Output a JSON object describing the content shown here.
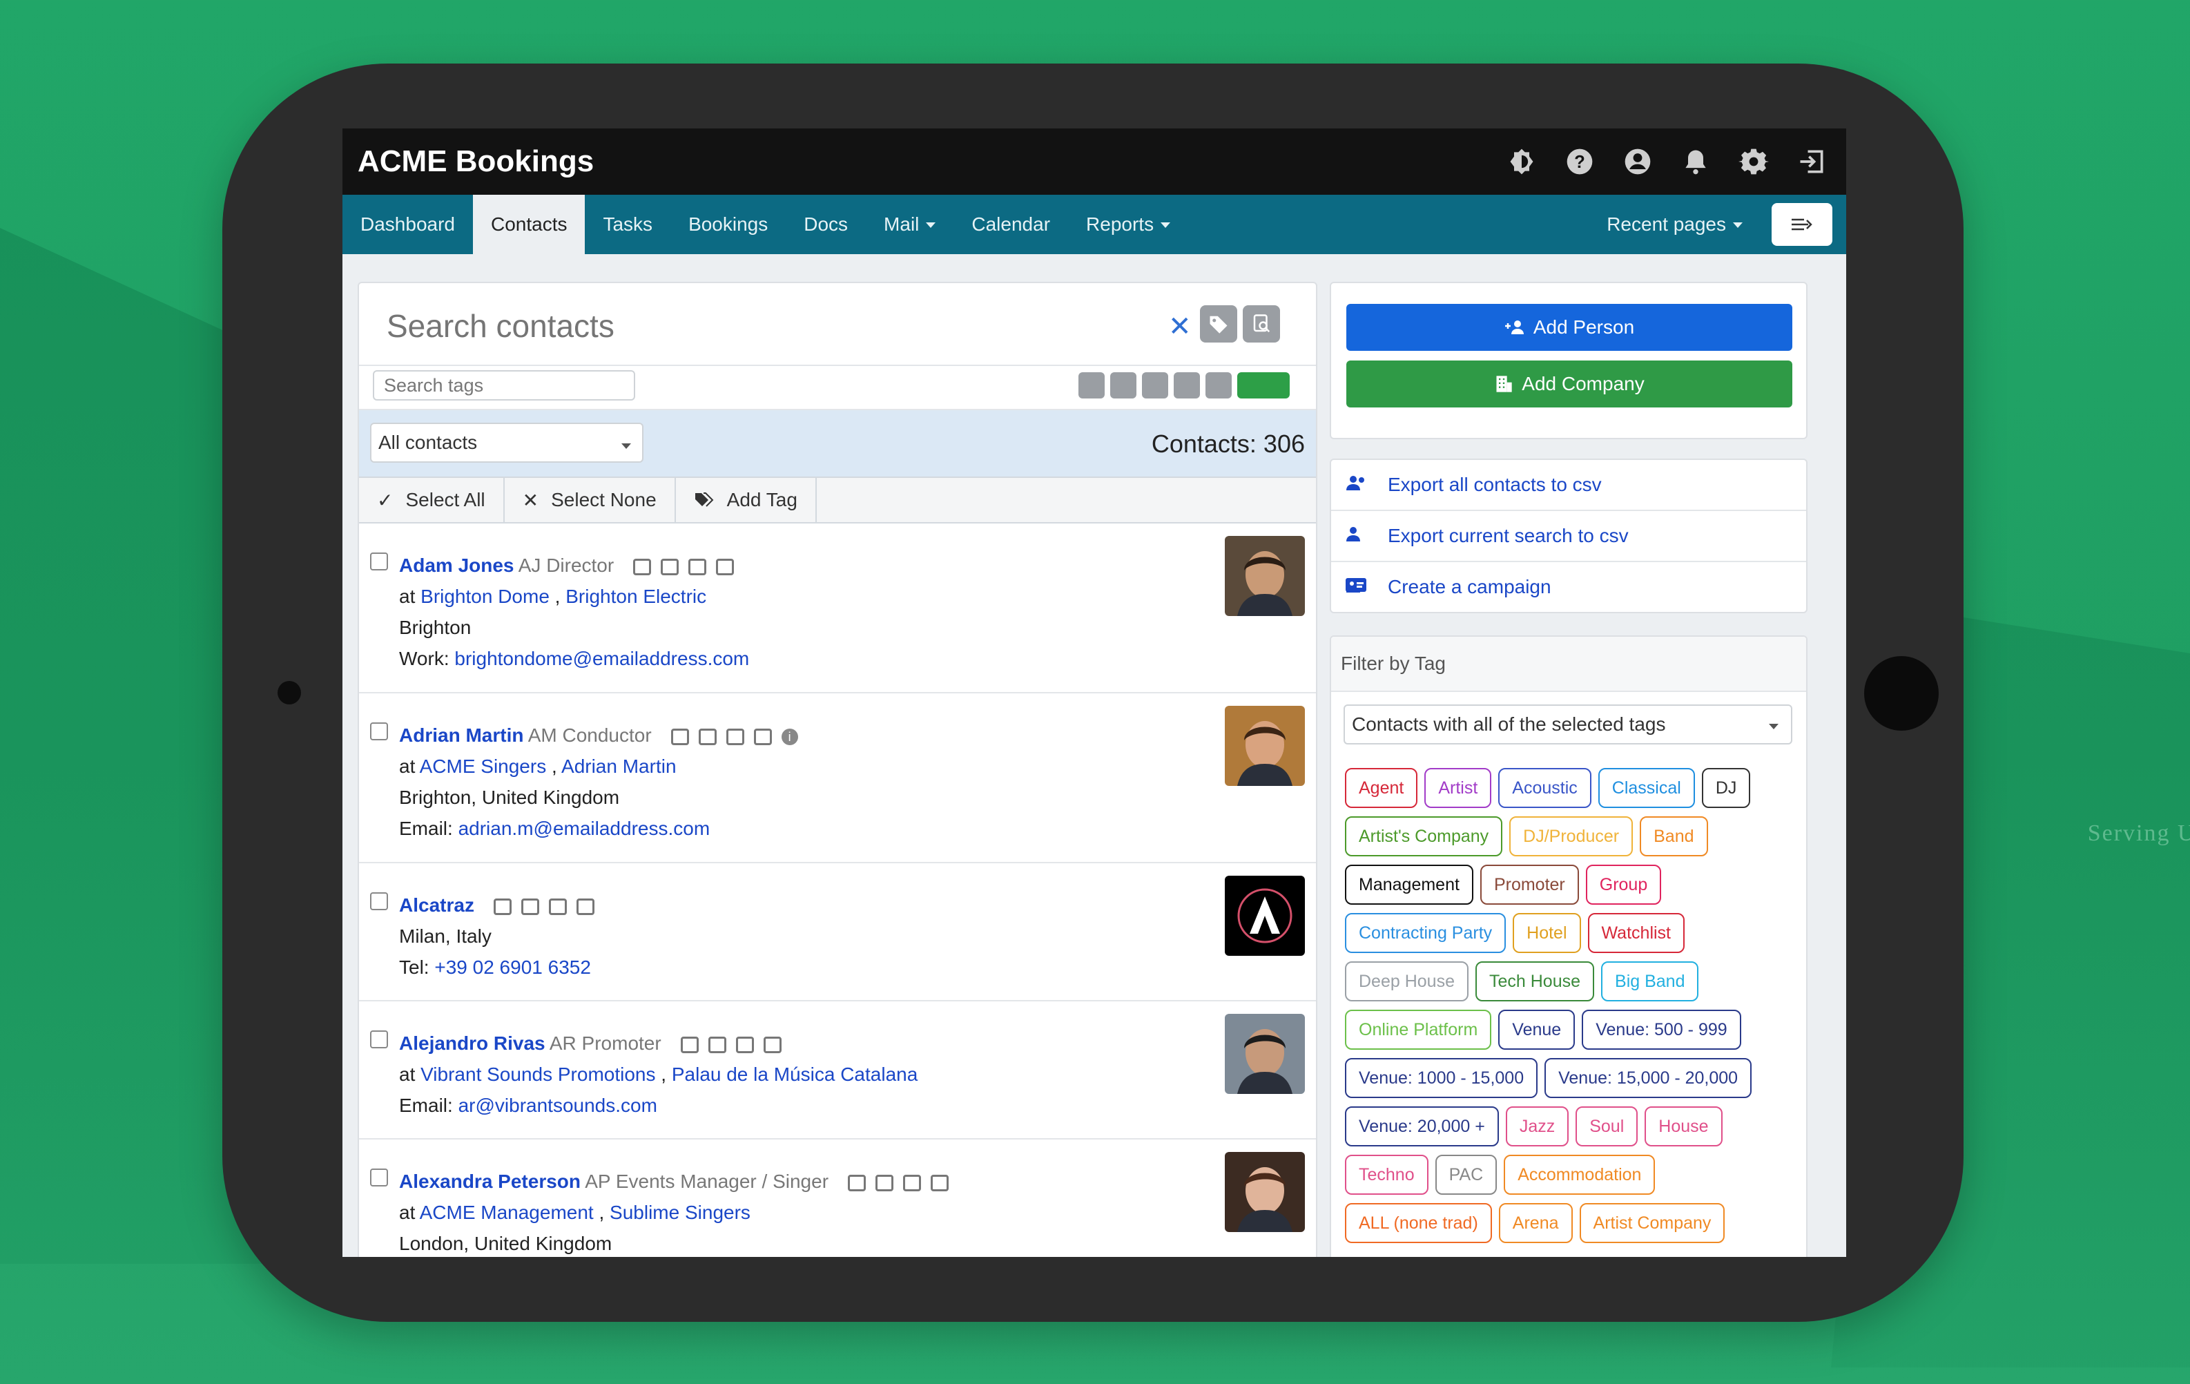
{
  "bg": {
    "caption": "Serving Ut"
  },
  "app": {
    "title": "ACME Bookings"
  },
  "top_icons": [
    "contrast-icon",
    "help-icon",
    "user-icon",
    "bell-icon",
    "gear-icon",
    "logout-icon"
  ],
  "nav": {
    "items": [
      {
        "label": "Dashboard",
        "active": false,
        "caret": false
      },
      {
        "label": "Contacts",
        "active": true,
        "caret": false
      },
      {
        "label": "Tasks",
        "active": false,
        "caret": false
      },
      {
        "label": "Bookings",
        "active": false,
        "caret": false
      },
      {
        "label": "Docs",
        "active": false,
        "caret": false
      },
      {
        "label": "Mail",
        "active": false,
        "caret": true
      },
      {
        "label": "Calendar",
        "active": false,
        "caret": false
      },
      {
        "label": "Reports",
        "active": false,
        "caret": true
      }
    ],
    "recent": "Recent pages"
  },
  "search": {
    "placeholder": "Search contacts",
    "tags_placeholder": "Search tags"
  },
  "filter": {
    "selected": "All contacts",
    "count": "Contacts: 306"
  },
  "actions": {
    "select_all": "Select All",
    "select_none": "Select None",
    "add_tag": "Add Tag"
  },
  "contacts": [
    {
      "name": "Adam Jones",
      "role": "AJ Director",
      "info": false,
      "lines": [
        {
          "prefix": "at ",
          "links": [
            "Brighton Dome",
            "Brighton Electric"
          ]
        },
        {
          "text": "Brighton"
        },
        {
          "prefix": "Work: ",
          "links": [
            "brightondome@emailaddress.com"
          ]
        }
      ],
      "photo": {
        "bg": "#5a4a3a",
        "skin": "#c99a76",
        "hair": "#2a1d14"
      }
    },
    {
      "name": "Adrian Martin",
      "role": "AM Conductor",
      "info": true,
      "lines": [
        {
          "prefix": "at ",
          "links": [
            "ACME Singers",
            "Adrian Martin"
          ]
        },
        {
          "text": "Brighton, United Kingdom"
        },
        {
          "prefix": "Email: ",
          "links": [
            "adrian.m@emailaddress.com"
          ]
        }
      ],
      "photo": {
        "bg": "#b07a3a",
        "skin": "#d9a37f",
        "hair": "#3b2414"
      }
    },
    {
      "name": "Alcatraz",
      "role": "",
      "info": false,
      "lines": [
        {
          "text": "Milan, Italy"
        },
        {
          "prefix": "Tel: ",
          "links": [
            "+39 02 6901 6352"
          ]
        }
      ],
      "photo": {
        "logo": true
      }
    },
    {
      "name": "Alejandro Rivas",
      "role": "AR Promoter",
      "info": false,
      "lines": [
        {
          "prefix": "at ",
          "links": [
            "Vibrant Sounds Promotions",
            "Palau de la Música Catalana"
          ]
        },
        {
          "prefix": "Email: ",
          "links": [
            "ar@vibrantsounds.com"
          ]
        }
      ],
      "photo": {
        "bg": "#7e8a96",
        "skin": "#c79a7b",
        "hair": "#1c1c1c"
      }
    },
    {
      "name": "Alexandra Peterson",
      "role": "AP Events Manager / Singer",
      "info": false,
      "lines": [
        {
          "prefix": "at ",
          "links": [
            "ACME Management",
            "Sublime Singers"
          ]
        },
        {
          "text": "London, United Kingdom"
        }
      ],
      "photo": {
        "bg": "#3c2b22",
        "skin": "#e0b49a",
        "hair": "#4a2a1a"
      }
    }
  ],
  "right": {
    "add_person": "Add Person",
    "add_company": "Add Company",
    "exports": [
      {
        "label": "Export all contacts to csv",
        "icon": "users-icon"
      },
      {
        "label": "Export current search to csv",
        "icon": "user-search-icon"
      },
      {
        "label": "Create a campaign",
        "icon": "id-card-icon"
      }
    ],
    "filter_title": "Filter by Tag",
    "tag_mode": "Contacts with all of the selected tags",
    "tags": [
      {
        "label": "Agent",
        "color": "#d62839"
      },
      {
        "label": "Artist",
        "color": "#a23cc8"
      },
      {
        "label": "Acoustic",
        "color": "#3a56c8"
      },
      {
        "label": "Classical",
        "color": "#1f8fe0"
      },
      {
        "label": "DJ",
        "color": "#333333"
      },
      {
        "label": "Artist's Company",
        "color": "#4c9a2a"
      },
      {
        "label": "DJ/Producer",
        "color": "#f0b33a"
      },
      {
        "label": "Band",
        "color": "#f08a24"
      },
      {
        "label": "Management",
        "color": "#111111"
      },
      {
        "label": "Promoter",
        "color": "#8a4a3a"
      },
      {
        "label": "Group",
        "color": "#e0245e"
      },
      {
        "label": "Contracting Party",
        "color": "#2a8fe0"
      },
      {
        "label": "Hotel",
        "color": "#e0a020"
      },
      {
        "label": "Watchlist",
        "color": "#d62839"
      },
      {
        "label": "Deep House",
        "color": "#9aa0a6"
      },
      {
        "label": "Tech House",
        "color": "#3a8a3a"
      },
      {
        "label": "Big Band",
        "color": "#22b0e0"
      },
      {
        "label": "Online Platform",
        "color": "#6cc04a"
      },
      {
        "label": "Venue",
        "color": "#2a3a8a"
      },
      {
        "label": "Venue: 500 - 999",
        "color": "#2a3a8a"
      },
      {
        "label": "Venue: 1000 - 15,000",
        "color": "#2a3a8a"
      },
      {
        "label": "Venue: 15,000 - 20,000",
        "color": "#2a3a8a"
      },
      {
        "label": "Venue: 20,000 +",
        "color": "#2a3a8a"
      },
      {
        "label": "Jazz",
        "color": "#e0508a"
      },
      {
        "label": "Soul",
        "color": "#e0508a"
      },
      {
        "label": "House",
        "color": "#e0508a"
      },
      {
        "label": "Techno",
        "color": "#e0508a"
      },
      {
        "label": "PAC",
        "color": "#888888"
      },
      {
        "label": "Accommodation",
        "color": "#f08a24"
      },
      {
        "label": "ALL (none trad)",
        "color": "#f06a24"
      },
      {
        "label": "Arena",
        "color": "#f08a24"
      },
      {
        "label": "Artist Company",
        "color": "#f08a24"
      }
    ]
  }
}
